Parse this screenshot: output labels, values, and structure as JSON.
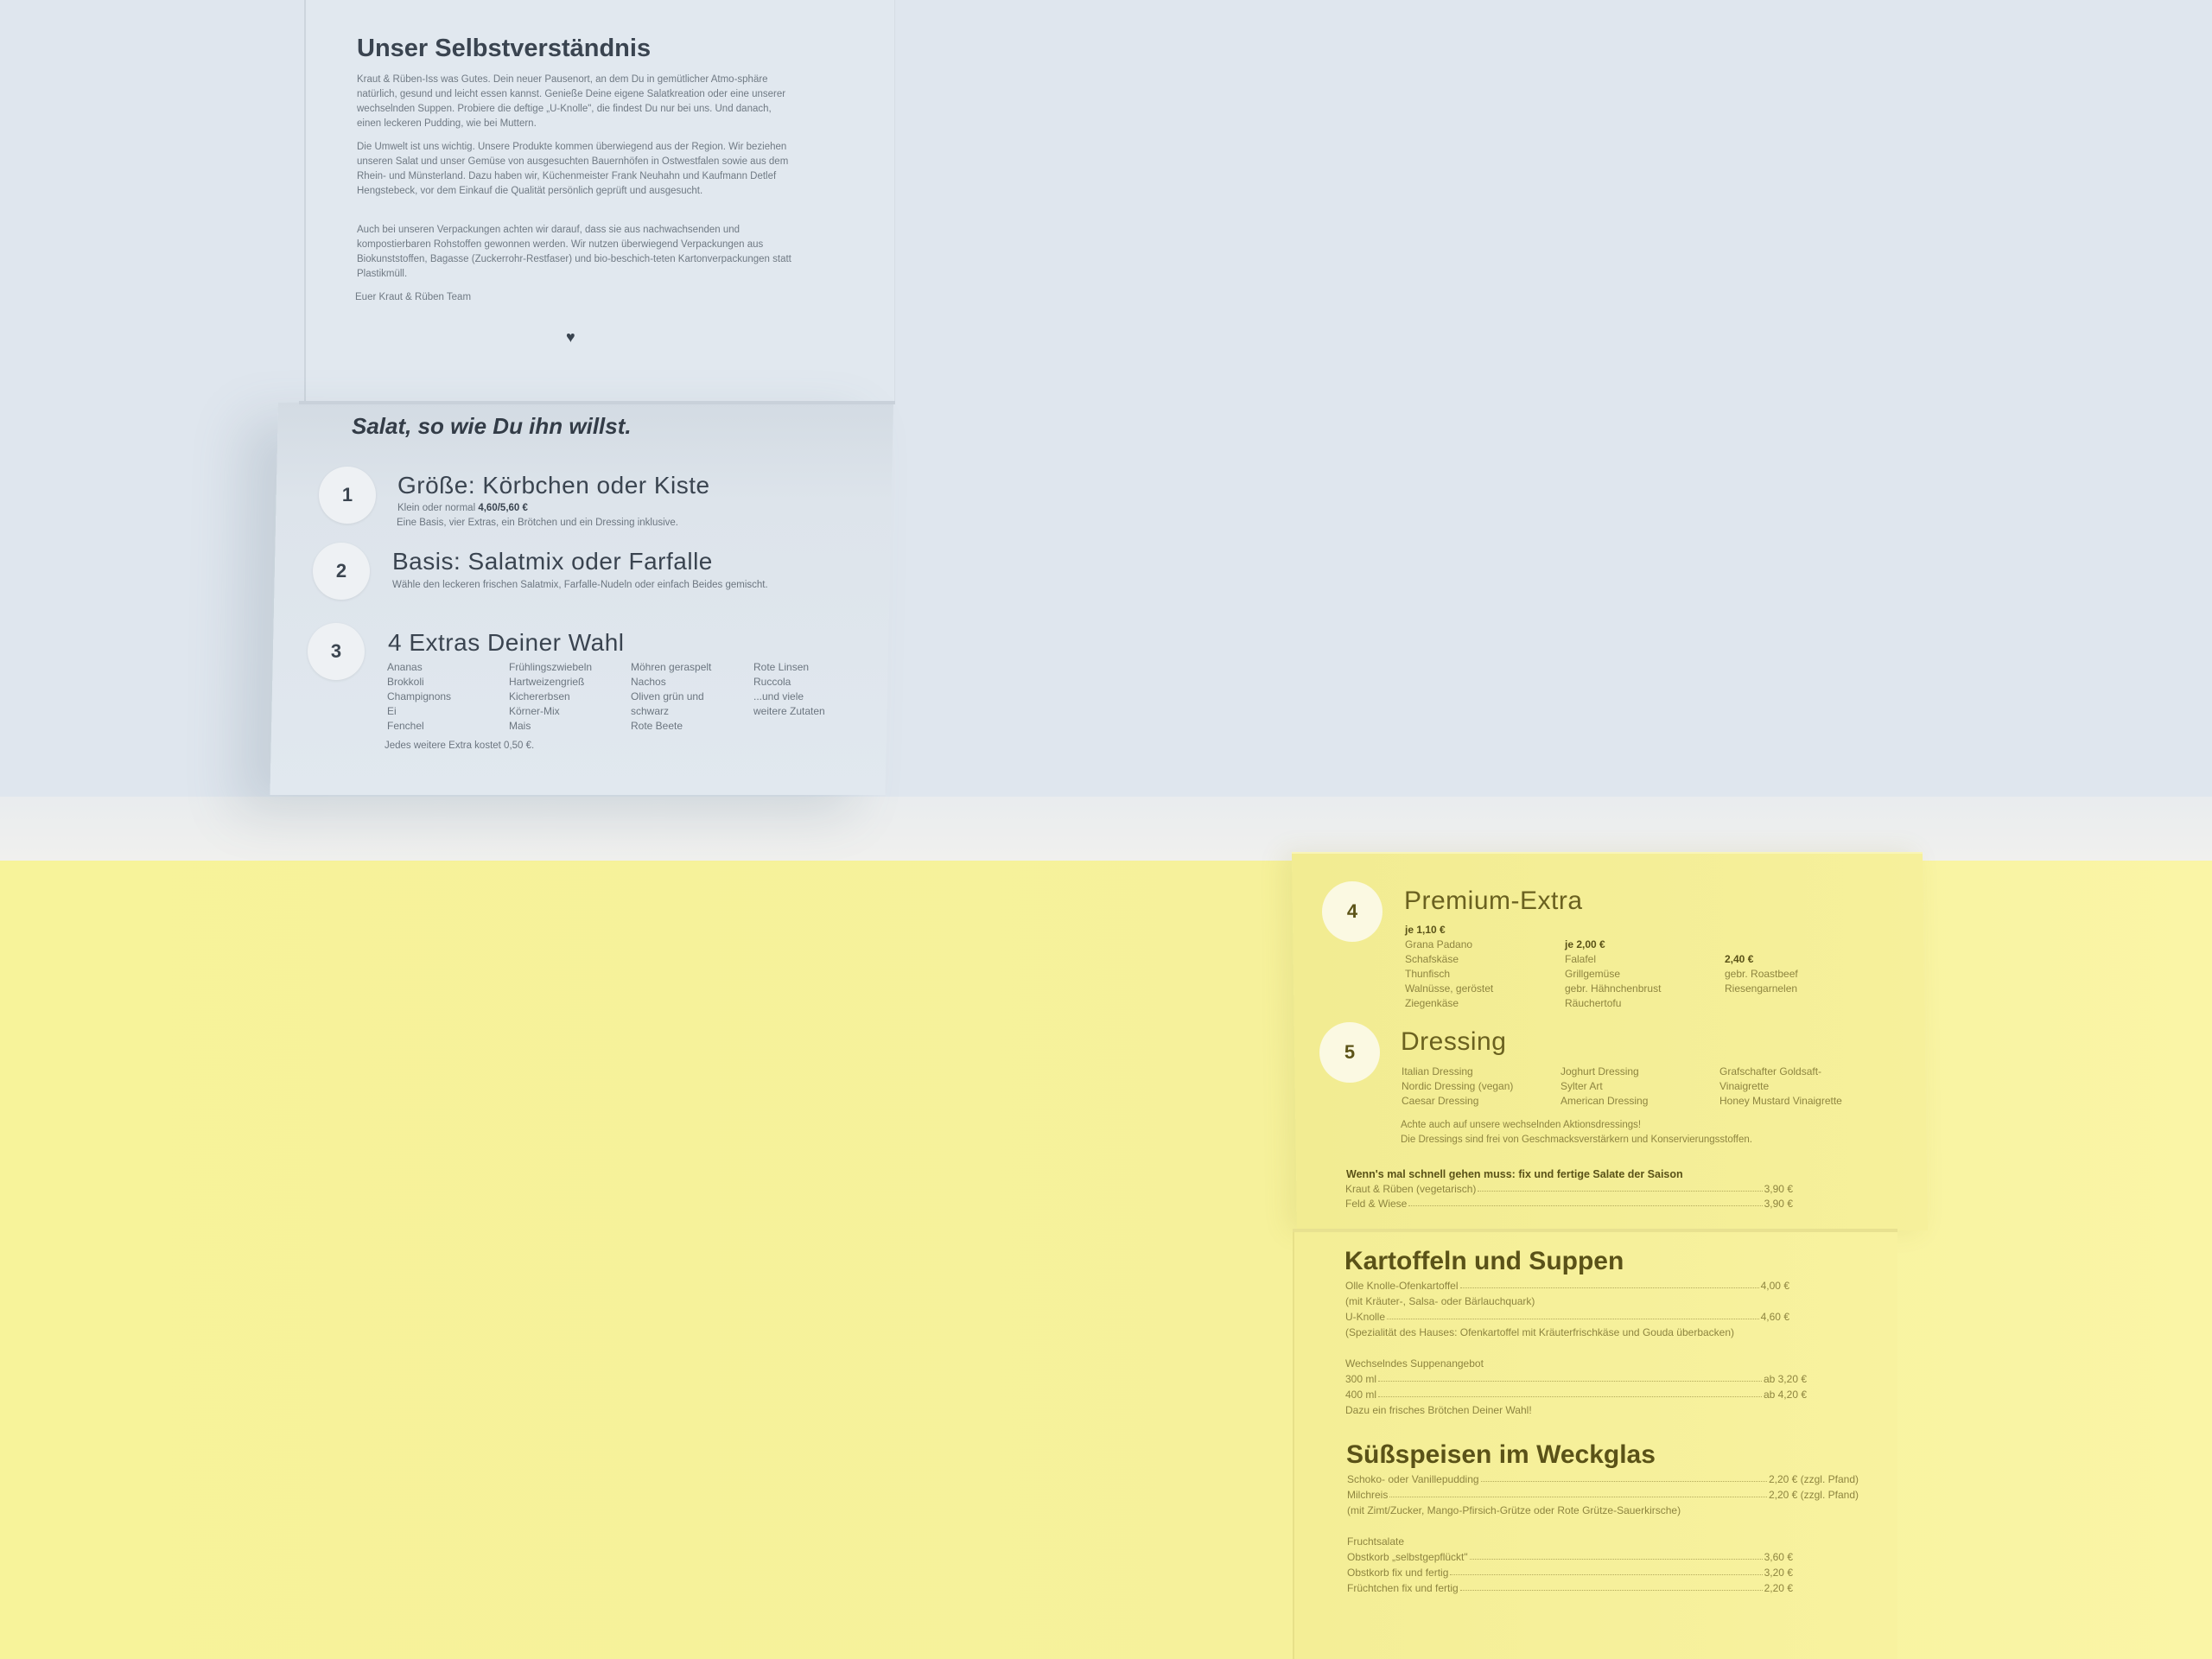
{
  "blue_menu": {
    "title": "Unser Selbstverständnis",
    "paragraphs": [
      "Kraut & Rüben-Iss was Gutes. Dein neuer Pausenort, an dem Du in gemütlicher Atmo-sphäre natürlich, gesund und leicht essen kannst. Genieße Deine eigene Salatkreation oder eine unserer wechselnden Suppen. Probiere die deftige „U-Knolle\", die findest Du nur bei uns. Und danach, einen leckeren Pudding, wie bei Muttern.",
      "Die Umwelt ist uns wichtig. Unsere Produkte kommen überwiegend aus der Region. Wir beziehen unseren Salat und unser Gemüse von ausgesuchten Bauernhöfen in Ostwestfalen sowie aus dem Rhein- und Münsterland. Dazu haben wir, Küchenmeister Frank Neuhahn und Kaufmann Detlef Hengstebeck, vor dem Einkauf die Qualität persönlich geprüft und ausgesucht.",
      "Auch bei unseren Verpackungen achten wir darauf, dass sie aus nachwachsenden und kompostierbaren Rohstoffen gewonnen werden. Wir nutzen überwiegend Verpackungen aus Biokunststoffen, Bagasse (Zuckerrohr-Restfaser) und bio-beschich-teten Kartonverpackungen statt Plastikmüll."
    ],
    "signature": "Euer Kraut & Rüben Team",
    "heart": "♥",
    "subtitle": "Salat, so wie Du ihn willst.",
    "step1": {
      "number": "1",
      "title": "Größe: Körbchen oder Kiste",
      "line1_text": "Klein oder normal",
      "line1_price": "4,60/5,60 €",
      "line2": "Eine Basis, vier Extras, ein Brötchen und ein Dressing inklusive."
    },
    "step2": {
      "number": "2",
      "title": "Basis: Salatmix oder Farfalle",
      "line1": "Wähle den leckeren frischen Salatmix, Farfalle-Nudeln oder einfach Beides gemischt."
    },
    "step3": {
      "number": "3",
      "title": "4 Extras Deiner Wahl",
      "columns": [
        [
          "Ananas",
          "Brokkoli",
          "Champignons",
          "Ei",
          "Fenchel"
        ],
        [
          "Frühlingszwiebeln",
          "Hartweizengrieß",
          "Kichererbsen",
          "Körner-Mix",
          "Mais"
        ],
        [
          "Möhren geraspelt",
          "Nachos",
          "Oliven grün und",
          "schwarz",
          "Rote Beete"
        ],
        [
          "Rote Linsen",
          "Ruccola",
          "...und viele",
          "weitere Zutaten"
        ]
      ],
      "note": "Jedes weitere Extra kostet 0,50 €."
    }
  },
  "yellow_menu": {
    "step4": {
      "number": "4",
      "title": "Premium-Extra",
      "columns": [
        {
          "price": "je 1,10 €",
          "items": [
            "Grana Padano",
            "Schafskäse",
            "Thunfisch",
            "Walnüsse, geröstet",
            "Ziegenkäse"
          ]
        },
        {
          "price": "je 2,00 €",
          "items": [
            "Falafel",
            "Grillgemüse",
            "gebr. Hähnchenbrust",
            "Räuchertofu"
          ]
        },
        {
          "price": "2,40 €",
          "items": [
            "gebr. Roastbeef",
            "Riesengarnelen"
          ]
        }
      ]
    },
    "step5": {
      "number": "5",
      "title": "Dressing",
      "columns": [
        [
          "Italian Dressing",
          "Nordic Dressing (vegan)",
          "Caesar Dressing"
        ],
        [
          "Joghurt Dressing",
          "Sylter Art",
          "American Dressing"
        ],
        [
          "Grafschafter Goldsaft-",
          "Vinaigrette",
          "Honey Mustard Vinaigrette"
        ]
      ],
      "notes": [
        "Achte auch auf unsere wechselnden Aktionsdressings!",
        "Die Dressings sind frei von Geschmacksverstärkern und Konservierungsstoffen."
      ]
    },
    "quick": {
      "heading": "Wenn's mal schnell gehen muss: fix und fertige Salate der Saison",
      "items": [
        {
          "name": "Kraut & Rüben (vegetarisch)",
          "price": "3,90 €"
        },
        {
          "name": "Feld & Wiese",
          "price": "3,90 €"
        }
      ]
    },
    "kartoffeln": {
      "heading": "Kartoffeln und Suppen",
      "item1_name": "Olle Knolle-Ofenkartoffel",
      "item1_price": "4,00 €",
      "item1_note": "(mit Kräuter-, Salsa- oder Bärlauchquark)",
      "item2_name": "U-Knolle",
      "item2_price": "4,60 €",
      "item2_note": "(Spezialität des Hauses: Ofenkartoffel mit Kräuterfrischkäse und Gouda überbacken)",
      "soup_title": "Wechselndes Suppenangebot",
      "soup1_name": "300 ml",
      "soup1_price": "ab 3,20 €",
      "soup2_name": "400 ml",
      "soup2_price": "ab 4,20 €",
      "soup_note": "Dazu ein frisches Brötchen Deiner Wahl!"
    },
    "suess": {
      "heading": "Süßspeisen im Weckglas",
      "item1_name": "Schoko- oder Vanillepudding",
      "item1_price": "2,20 €  (zzgl. Pfand)",
      "item2_name": "Milchreis",
      "item2_price": "2,20 €  (zzgl. Pfand)",
      "item2_note": "(mit Zimt/Zucker, Mango-Pfirsich-Grütze oder Rote Grütze-Sauerkirsche)",
      "fruit_title": "Fruchtsalate",
      "fruit1_name": "Obstkorb „selbstgepflückt\"",
      "fruit1_price": "3,60 €",
      "fruit2_name": "Obstkorb fix und fertig",
      "fruit2_price": "3,20 €",
      "fruit3_name": "Früchtchen fix und fertig",
      "fruit3_price": "2,20 €"
    }
  }
}
